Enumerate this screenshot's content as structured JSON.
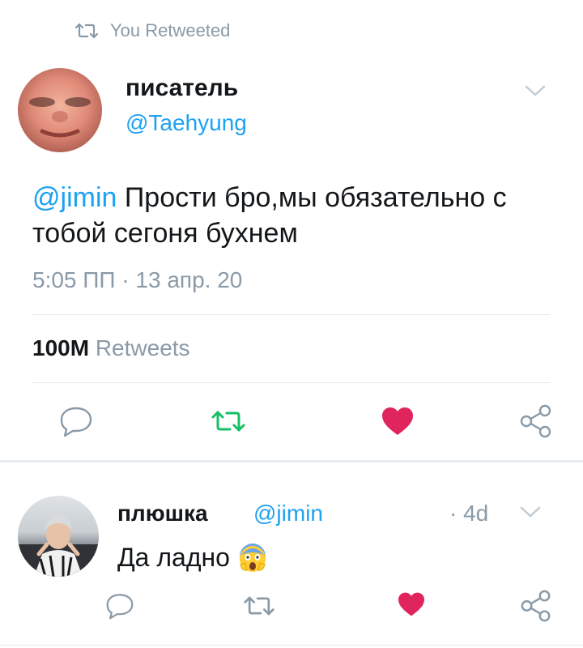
{
  "retweet_header": {
    "label": "You Retweeted",
    "icon": "retweet-icon"
  },
  "main_tweet": {
    "display_name": "писатель",
    "handle": "@Taehyung",
    "mention": "@jimin",
    "text": " Прости бро,мы обязательно с тобой сегоня бухнем",
    "time": "5:05 ПП",
    "separator": " · ",
    "date": "13 апр. 20",
    "stats": {
      "count": "100M",
      "label": " Retweets"
    },
    "actions": {
      "retweeted": true,
      "liked": true
    }
  },
  "reply_tweet": {
    "display_name": "плюшка",
    "handle": "@jimin",
    "time": "· 4d",
    "text": "Да ладно",
    "emoji": "screaming-face-icon"
  },
  "colors": {
    "accent": "#1da1f2",
    "retweet_active": "#17bf63",
    "like_active": "#e0245e",
    "grey": "#8a9aa8"
  }
}
